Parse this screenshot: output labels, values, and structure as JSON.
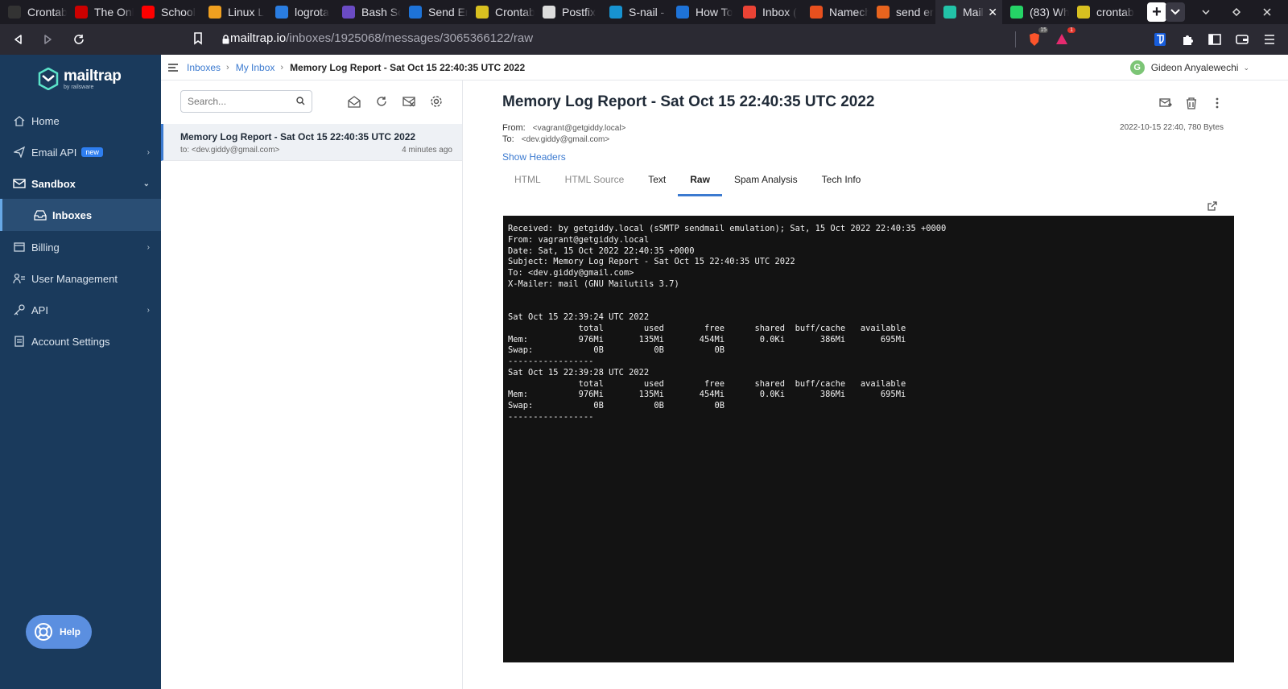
{
  "browser": {
    "tabs": [
      {
        "label": "Crontab",
        "favicon_color": "#333333",
        "favicon": "scissors-icon"
      },
      {
        "label": "The Onl",
        "favicon_color": "#cc0000",
        "favicon": "redhat-icon"
      },
      {
        "label": "School",
        "favicon_color": "#ff0000",
        "favicon": "youtube-icon"
      },
      {
        "label": "Linux L",
        "favicon_color": "#f0a020",
        "favicon": "linux-icon"
      },
      {
        "label": "logrota",
        "favicon_color": "#2a7de1",
        "favicon": "lg-icon"
      },
      {
        "label": "Bash Sc",
        "favicon_color": "#6a4bc4",
        "favicon": "h-icon"
      },
      {
        "label": "Send En",
        "favicon_color": "#1e73d8",
        "favicon": "digitalocean-icon"
      },
      {
        "label": "Crontab",
        "favicon_color": "#d8c020",
        "favicon": "c-icon"
      },
      {
        "label": "Postfix",
        "favicon_color": "#dddddd",
        "favicon": "postfix-icon"
      },
      {
        "label": "S-nail - /",
        "favicon_color": "#1793d1",
        "favicon": "arch-icon"
      },
      {
        "label": "How To",
        "favicon_color": "#1e73d8",
        "favicon": "digitalocean-icon"
      },
      {
        "label": "Inbox (",
        "favicon_color": "#ea4335",
        "favicon": "gmail-icon"
      },
      {
        "label": "Namech",
        "favicon_color": "#e8501e",
        "favicon": "namecheap-icon"
      },
      {
        "label": "send er",
        "favicon_color": "#e8641e",
        "favicon": "duckduckgo-icon"
      },
      {
        "label": "Mail",
        "favicon_color": "#22c3a8",
        "favicon": "mailtrap-icon",
        "active": true
      },
      {
        "label": "(83) Wh",
        "favicon_color": "#25d366",
        "favicon": "whatsapp-icon"
      },
      {
        "label": "crontab",
        "favicon_color": "#d8c020",
        "favicon": "c-icon"
      }
    ],
    "new_tab_label": "+",
    "url_host": "mailtrap.io",
    "url_path": "/inboxes/1925068/messages/3065366122/raw",
    "brave_shield_count": "15",
    "rewards_count": "1"
  },
  "sidebar": {
    "brand": "mailtrap",
    "brand_sub": "by railsware",
    "items": [
      {
        "label": "Home",
        "icon": "home-icon"
      },
      {
        "label": "Email API",
        "icon": "send-icon",
        "badge": "new",
        "chevron": "›"
      },
      {
        "label": "Sandbox",
        "icon": "sandbox-icon",
        "chevron": "⌄"
      },
      {
        "label": "Inboxes",
        "icon": "inbox-icon"
      },
      {
        "label": "Billing",
        "icon": "billing-icon",
        "chevron": "›"
      },
      {
        "label": "User Management",
        "icon": "users-icon"
      },
      {
        "label": "API",
        "icon": "key-icon",
        "chevron": "›"
      },
      {
        "label": "Account Settings",
        "icon": "settings-doc-icon"
      }
    ],
    "help_label": "Help"
  },
  "topbar": {
    "breadcrumb": [
      "Inboxes",
      "My Inbox",
      "Memory Log Report - Sat Oct 15 22:40:35 UTC 2022"
    ],
    "user_initial": "G",
    "user_name": "Gideon Anyalewechi"
  },
  "list": {
    "search_placeholder": "Search...",
    "messages": [
      {
        "subject": "Memory Log Report - Sat Oct 15 22:40:35 UTC 2022",
        "to": "to: <dev.giddy@gmail.com>",
        "time": "4 minutes ago"
      }
    ]
  },
  "message": {
    "subject": "Memory Log Report - Sat Oct 15 22:40:35 UTC 2022",
    "from_label": "From:",
    "from": "<vagrant@getgiddy.local>",
    "to_label": "To:",
    "to": "<dev.giddy@gmail.com>",
    "meta": "2022-10-15 22:40, 780 Bytes",
    "show_headers": "Show Headers",
    "tabs": [
      "HTML",
      "HTML Source",
      "Text",
      "Raw",
      "Spam Analysis",
      "Tech Info"
    ],
    "active_tab": "Raw",
    "raw": "Received: by getgiddy.local (sSMTP sendmail emulation); Sat, 15 Oct 2022 22:40:35 +0000\nFrom: vagrant@getgiddy.local\nDate: Sat, 15 Oct 2022 22:40:35 +0000\nSubject: Memory Log Report - Sat Oct 15 22:40:35 UTC 2022\nTo: <dev.giddy@gmail.com>\nX-Mailer: mail (GNU Mailutils 3.7)\n\n\nSat Oct 15 22:39:24 UTC 2022\n              total        used        free      shared  buff/cache   available\nMem:          976Mi       135Mi       454Mi       0.0Ki       386Mi       695Mi\nSwap:            0B          0B          0B\n-----------------\nSat Oct 15 22:39:28 UTC 2022\n              total        used        free      shared  buff/cache   available\nMem:          976Mi       135Mi       454Mi       0.0Ki       386Mi       695Mi\nSwap:            0B          0B          0B\n-----------------"
  }
}
